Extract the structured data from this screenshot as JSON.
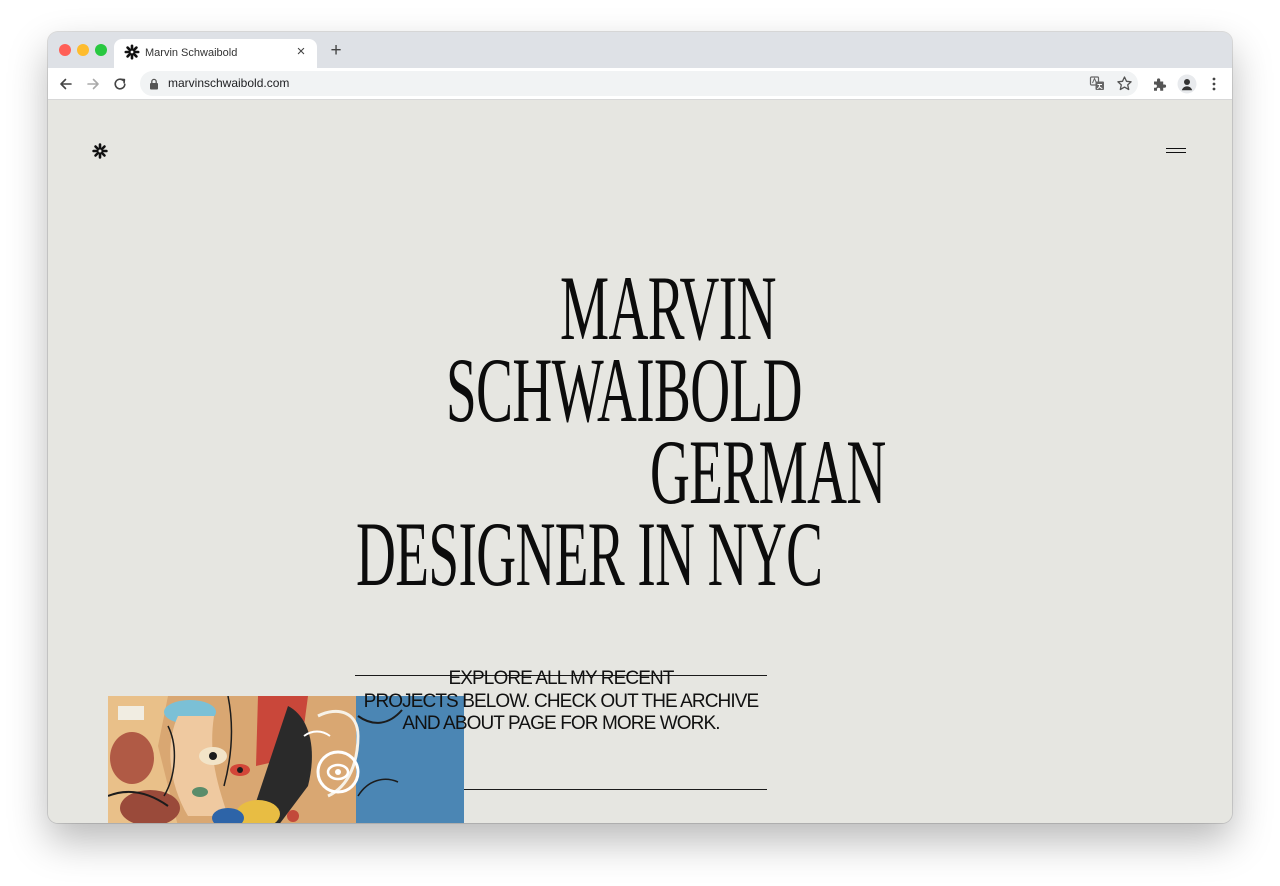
{
  "browser": {
    "tab_title": "Marvin Schwaibold",
    "url": "marvinschwaibold.com",
    "tab_close_glyph": "×",
    "new_tab_glyph": "+",
    "traffic_lights": {
      "close": "#ff5f57",
      "minimize": "#febc2e",
      "maximize": "#28c840"
    },
    "icons": [
      "back-arrow-icon",
      "forward-arrow-icon",
      "reload-icon",
      "lock-icon",
      "translate-icon",
      "star-icon",
      "extensions-icon",
      "profile-icon",
      "more-icon"
    ]
  },
  "site": {
    "hero": {
      "line1": "MARVIN",
      "line2": "SCHWAIBOLD",
      "line3": "GERMAN",
      "line4": "DESIGNER IN   NYC"
    },
    "intro": {
      "line1": "EXPLORE ALL MY RECENT",
      "line2": "PROJECTS BELOW. CHECK OUT THE ARCHIVE",
      "line3": "AND ABOUT PAGE FOR MORE WORK."
    },
    "colors": {
      "background": "#e6e6e1",
      "text": "#0c0c0c",
      "thumb_blue": "#4b86b4"
    }
  }
}
